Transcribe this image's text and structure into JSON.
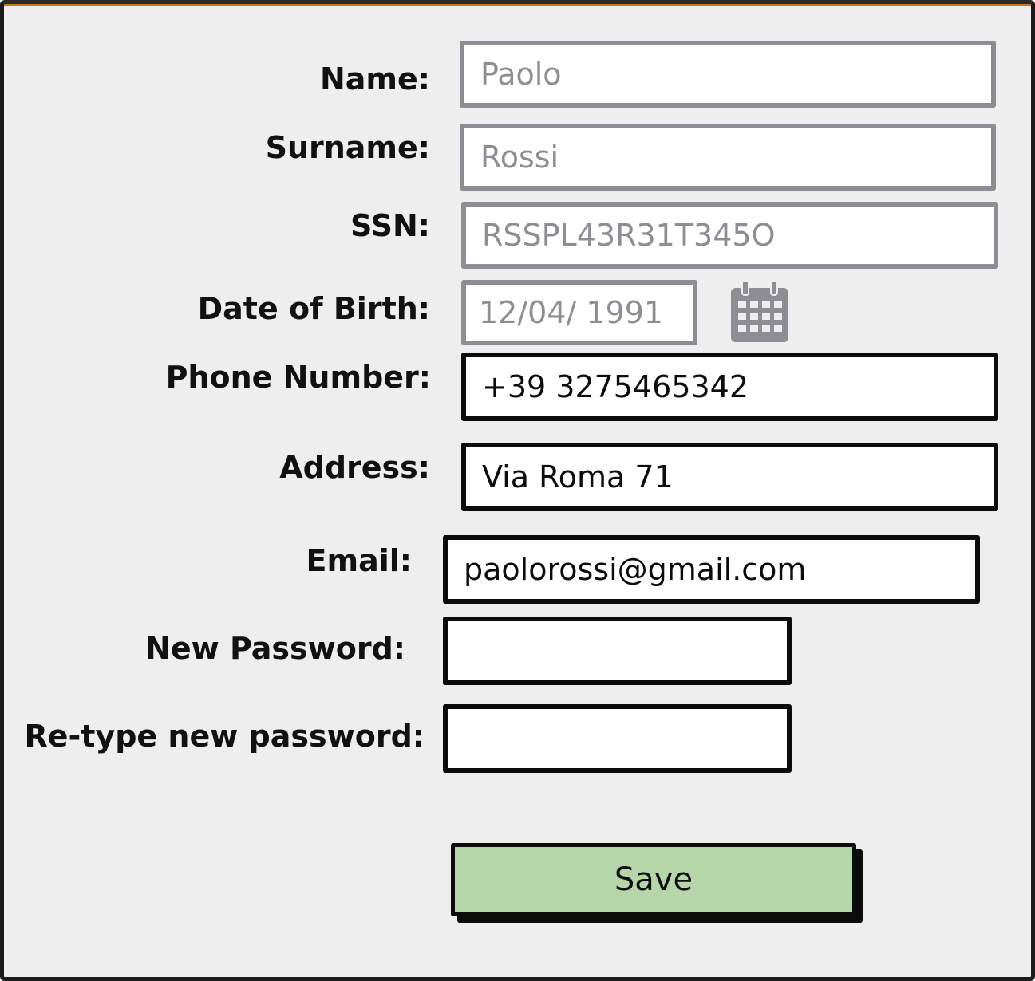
{
  "form": {
    "name": {
      "label": "Name:",
      "value": "Paolo"
    },
    "surname": {
      "label": "Surname:",
      "value": "Rossi"
    },
    "ssn": {
      "label": "SSN:",
      "value": "RSSPL43R31T345O"
    },
    "dob": {
      "label": "Date of Birth:",
      "value": "12/04/ 1991"
    },
    "phone": {
      "label": "Phone Number:",
      "value": "+39 3275465342"
    },
    "address": {
      "label": "Address:",
      "value": "Via Roma 71"
    },
    "email": {
      "label": "Email:",
      "value": "paolorossi@gmail.com"
    },
    "new_password": {
      "label": "New Password:",
      "value": ""
    },
    "retype_password": {
      "label": "Re-type new password:",
      "value": ""
    }
  },
  "actions": {
    "save_label": "Save"
  },
  "icons": {
    "date_picker": "calendar-icon"
  },
  "colors": {
    "disabled_field": "#8d8d93",
    "active_field": "#0c0c0c",
    "save_button": "#b5d6a8",
    "background": "#eeeeee"
  }
}
